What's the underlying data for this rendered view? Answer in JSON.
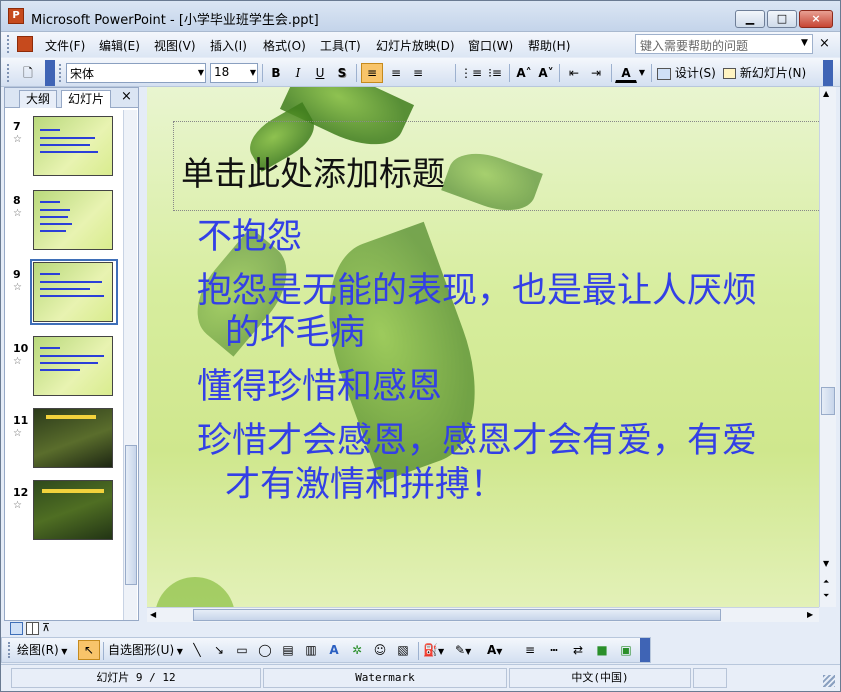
{
  "window": {
    "title": "Microsoft PowerPoint - [小学毕业班学生会.ppt]",
    "app_icon_text": "P",
    "caption_min": "▁",
    "caption_max": "□",
    "caption_close": "×"
  },
  "menubar": {
    "items": [
      "文件(F)",
      "编辑(E)",
      "视图(V)",
      "插入(I)",
      "格式(O)",
      "工具(T)",
      "幻灯片放映(D)",
      "窗口(W)",
      "帮助(H)"
    ],
    "help_placeholder": "键入需要帮助的问题",
    "close_glyph": "×"
  },
  "toolbar": {
    "new_glyph": "🗋",
    "font_name": "宋体",
    "font_size": "18",
    "bold": "B",
    "italic": "I",
    "underline": "U",
    "shadow": "S",
    "align_left": "≡",
    "align_center": "≡",
    "align_right": "≡",
    "numbered": "⋮≡",
    "bulleted": "⁝≡",
    "grow": "A˄",
    "shrink": "A˅",
    "decrease_indent": "⇤",
    "increase_indent": "⇥",
    "font_color": "A",
    "design_label": "设计(S)",
    "new_slide_label": "新幻灯片(N)"
  },
  "panel": {
    "tab_outline": "大纲",
    "tab_slides": "幻灯片",
    "close_glyph": "×",
    "thumbs": [
      {
        "num": "7",
        "star": "☆"
      },
      {
        "num": "8",
        "star": "☆"
      },
      {
        "num": "9",
        "star": "☆"
      },
      {
        "num": "10",
        "star": "☆"
      },
      {
        "num": "11",
        "star": "☆"
      },
      {
        "num": "12",
        "star": "☆"
      }
    ]
  },
  "slide": {
    "title": "单击此处添加标题",
    "bullets": [
      "不抱怨",
      "抱怨是无能的表现，也是最让人厌烦",
      "的坏毛病",
      "懂得珍惜和感恩",
      "珍惜才会感恩，感恩才会有爱，有爱",
      "才有激情和拼搏！"
    ]
  },
  "drawbar": {
    "draw_label": "绘图(R)",
    "autoshapes_label": "自选图形(U)"
  },
  "status": {
    "slide_pos": "幻灯片 9 / 12",
    "template": "Watermark",
    "language": "中文(中国)"
  },
  "colors": {
    "body_text": "#3340e6",
    "selected_thumb_border": "#3f6fb8"
  }
}
